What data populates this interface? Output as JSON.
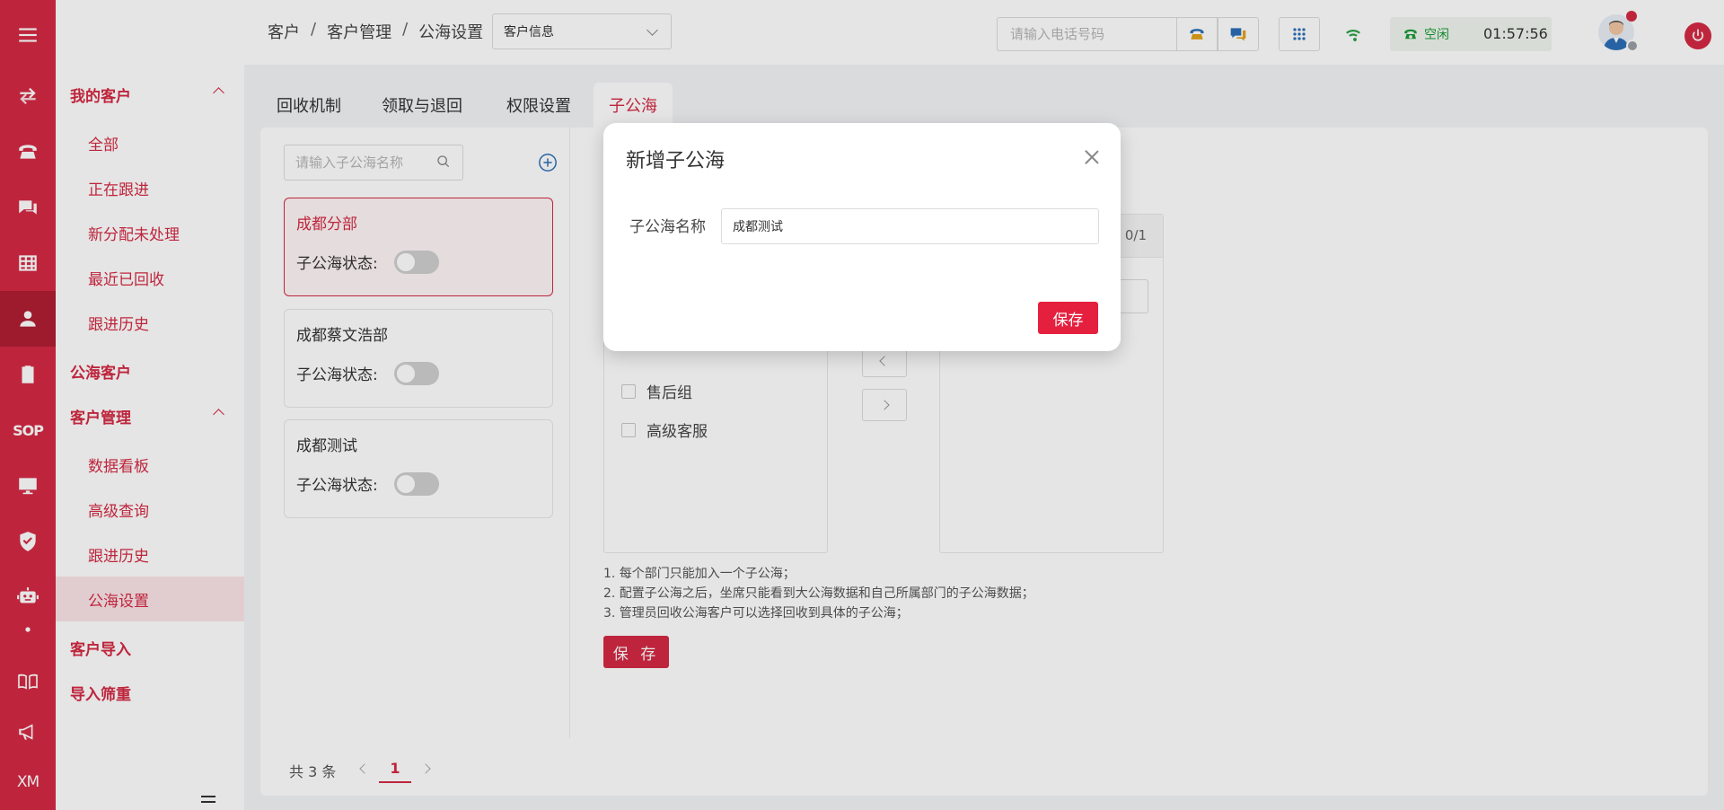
{
  "rail": {
    "icons": [
      "menu-icon",
      "switch-arrows-icon",
      "telephone-icon",
      "chat-icon",
      "grid-table-icon",
      "user-icon",
      "clipboard-icon",
      "sop-text",
      "monitor-chart-icon",
      "shield-check-icon",
      "robot-icon",
      "dot-icon",
      "book-icon",
      "megaphone-icon",
      "xm-text"
    ],
    "sop_label": "SOP",
    "xm_label": "XM"
  },
  "menu": {
    "my_customers": "我的客户",
    "my_items": [
      "全部",
      "正在跟进",
      "新分配未处理",
      "最近已回收",
      "跟进历史"
    ],
    "public_customers": "公海客户",
    "customer_mgmt": "客户管理",
    "mgmt_items": [
      "数据看板",
      "高级查询",
      "跟进历史",
      "公海设置"
    ],
    "customer_import": "客户导入",
    "import_dedupe": "导入筛重"
  },
  "header": {
    "breadcrumb": [
      "客户",
      "客户管理",
      "公海设置"
    ],
    "breadcrumb_sep": "/",
    "select_value": "客户信息",
    "phone_placeholder": "请输入电话号码",
    "status_text": "空闲",
    "timer": "01:57:56"
  },
  "tabs": [
    "回收机制",
    "领取与退回",
    "权限设置",
    "子公海"
  ],
  "sidebar": {
    "search_placeholder": "请输入子公海名称",
    "state_label": "子公海状态:",
    "cards": [
      {
        "name": "成都分部",
        "enabled": false
      },
      {
        "name": "成都蔡文浩部",
        "enabled": false
      },
      {
        "name": "成都测试",
        "enabled": false
      }
    ]
  },
  "transfer": {
    "right_count": "0/1",
    "left_items": [
      "售后组",
      "高级客服"
    ]
  },
  "notes": [
    "1. 每个部门只能加入一个子公海；",
    "2. 配置子公海之后，坐席只能看到大公海数据和自己所属部门的子公海数据；",
    "3. 管理员回收公海客户可以选择回收到具体的子公海；"
  ],
  "save_button": "保 存",
  "pager": {
    "total": "共 3 条",
    "current": "1"
  },
  "modal": {
    "title": "新增子公海",
    "field_label": "子公海名称",
    "field_value": "成都测试",
    "save": "保存"
  },
  "colors": {
    "brand": "#d42a43",
    "modal_save": "#e5203e",
    "status_green": "#1e9a3a"
  }
}
